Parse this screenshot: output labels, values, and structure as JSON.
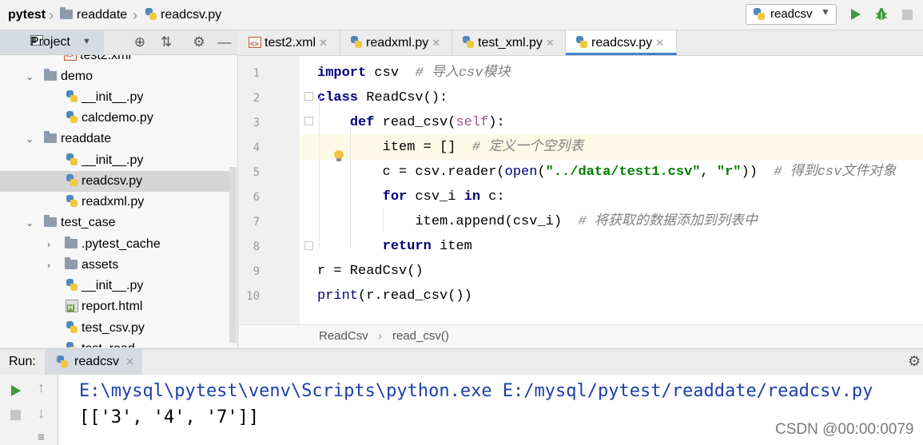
{
  "navbar": {
    "project": "pytest",
    "folder": "readdate",
    "file": "readcsv.py"
  },
  "toolbar": {
    "run_config": "readcsv",
    "run_icon": "play-icon",
    "debug_icon": "bug-icon",
    "stop_icon": "stop-icon",
    "accent_run": "#3d9a3d"
  },
  "project_pane": {
    "title": "Project",
    "items": [
      {
        "label": "test2.xml",
        "type": "xml"
      },
      {
        "label": "demo",
        "type": "folder",
        "expanded": true
      },
      {
        "label": "__init__.py",
        "type": "py"
      },
      {
        "label": "calcdemo.py",
        "type": "py"
      },
      {
        "label": "readdate",
        "type": "folder",
        "expanded": true
      },
      {
        "label": "__init__.py",
        "type": "py"
      },
      {
        "label": "readcsv.py",
        "type": "py",
        "selected": true
      },
      {
        "label": "readxml.py",
        "type": "py"
      },
      {
        "label": "test_case",
        "type": "folder",
        "expanded": true
      },
      {
        "label": ".pytest_cache",
        "type": "folder",
        "expanded": false
      },
      {
        "label": "assets",
        "type": "folder",
        "expanded": false
      },
      {
        "label": "__init__.py",
        "type": "py"
      },
      {
        "label": "report.html",
        "type": "html"
      },
      {
        "label": "test_csv.py",
        "type": "py"
      },
      {
        "label": "test_read",
        "type": "py"
      }
    ]
  },
  "editor_tabs": [
    {
      "label": "test2.xml",
      "type": "xml"
    },
    {
      "label": "readxml.py",
      "type": "py"
    },
    {
      "label": "test_xml.py",
      "type": "py"
    },
    {
      "label": "readcsv.py",
      "type": "py",
      "active": true
    }
  ],
  "code": {
    "line_numbers": [
      "1",
      "2",
      "3",
      "4",
      "5",
      "6",
      "7",
      "8",
      "9",
      "10"
    ],
    "lines": [
      [
        {
          "t": "import",
          "c": "kw"
        },
        {
          "t": " csv  "
        },
        {
          "t": "# 导入csv模块",
          "c": "cm"
        }
      ],
      [
        {
          "t": "class",
          "c": "kw"
        },
        {
          "t": " ReadCsv():"
        }
      ],
      [
        {
          "t": "    "
        },
        {
          "t": "def",
          "c": "kw"
        },
        {
          "t": " read_csv("
        },
        {
          "t": "self",
          "c": "sf"
        },
        {
          "t": "):"
        }
      ],
      [
        {
          "t": "        item = []  "
        },
        {
          "t": "# 定义一个空列表",
          "c": "cm"
        }
      ],
      [
        {
          "t": "        c = csv.reader("
        },
        {
          "t": "open",
          "c": "bi"
        },
        {
          "t": "("
        },
        {
          "t": "\"../data/test1.csv\"",
          "c": "st"
        },
        {
          "t": ", "
        },
        {
          "t": "\"r\"",
          "c": "st"
        },
        {
          "t": "))  "
        },
        {
          "t": "# 得到csv文件对象",
          "c": "cm"
        }
      ],
      [
        {
          "t": "        "
        },
        {
          "t": "for",
          "c": "kw"
        },
        {
          "t": " csv_i "
        },
        {
          "t": "in",
          "c": "kw"
        },
        {
          "t": " c:"
        }
      ],
      [
        {
          "t": "            item.append(csv_i)  "
        },
        {
          "t": "# 将获取的数据添加到列表中",
          "c": "cm"
        }
      ],
      [
        {
          "t": "        "
        },
        {
          "t": "return",
          "c": "kw"
        },
        {
          "t": " item"
        }
      ],
      [
        {
          "t": "r = ReadCsv()"
        }
      ],
      [
        {
          "t": "print",
          "c": "bi"
        },
        {
          "t": "(r.read_csv())"
        }
      ]
    ]
  },
  "editor_breadcrumb": {
    "class_name": "ReadCsv",
    "method_name": "read_csv()"
  },
  "run_window": {
    "label": "Run:",
    "tab": "readcsv",
    "output": [
      "E:\\mysql\\pytest\\venv\\Scripts\\python.exe E:/mysql/pytest/readdate/readcsv.py",
      "[['3', '4', '7']]"
    ],
    "output_color": "#1c3fa8"
  },
  "watermark": "CSDN @00:00:0079"
}
